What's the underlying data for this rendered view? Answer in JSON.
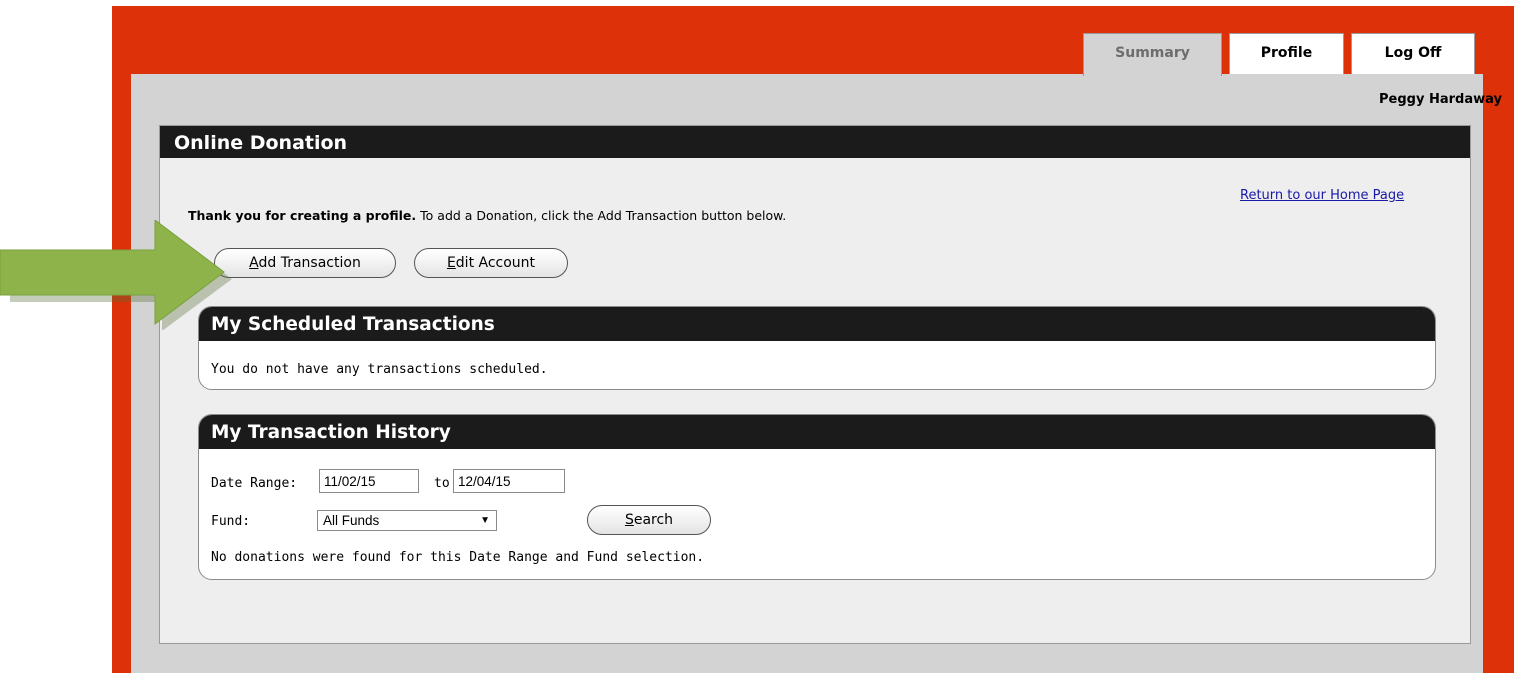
{
  "tabs": {
    "summary": "Summary",
    "profile": "Profile",
    "logoff": "Log Off"
  },
  "user": {
    "name": "Peggy Hardaway"
  },
  "panel": {
    "title": "Online Donation",
    "home_link": "Return to our Home Page",
    "thanks_bold": "Thank you for creating a profile.",
    "thanks_rest": " To add a Donation, click the Add Transaction button below.",
    "add_button": {
      "mnemonic": "A",
      "rest": "dd Transaction"
    },
    "edit_button": {
      "mnemonic": "E",
      "rest": "dit Account"
    }
  },
  "scheduled": {
    "title": "My Scheduled Transactions",
    "message": "You do not have any transactions scheduled."
  },
  "history": {
    "title": "My Transaction History",
    "date_range_label": "Date Range:",
    "date_from": "11/02/15",
    "to_label": "to",
    "date_to": "12/04/15",
    "fund_label": "Fund:",
    "fund_selected": "All Funds",
    "search_button": {
      "mnemonic": "S",
      "rest": "earch"
    },
    "message": "No donations were found for this Date Range and Fund selection."
  },
  "colors": {
    "frame": "#dc3109",
    "header": "#1b1b1b",
    "arrow": "#8db34a"
  },
  "icons": {
    "callout": "right-arrow-icon",
    "select": "dropdown-arrow-icon"
  }
}
